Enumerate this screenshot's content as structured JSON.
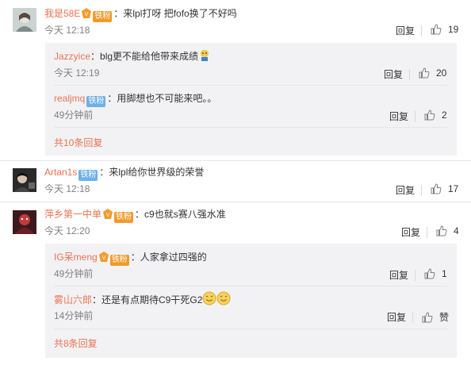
{
  "comments": [
    {
      "user": "我是58E",
      "badge": "铁粉",
      "text": "：来lpl打呀 把fofo换了不好吗",
      "time": "今天 12:18",
      "reply_label": "回复",
      "likes": "19",
      "replies": [
        {
          "user": "Jazzyice",
          "text": "：blg更不能给他带来成绩",
          "time": "今天 12:19",
          "reply_label": "回复",
          "likes": "20"
        },
        {
          "user": "realjmq",
          "badge": "铁粉",
          "text": "：用脚想也不可能来吧。。",
          "time": "49分钟前",
          "reply_label": "回复",
          "likes": "2"
        }
      ],
      "more": "共10条回复"
    },
    {
      "user": "Artan1s",
      "badge": "铁粉",
      "text": "：来lpl给你世界级的荣誉",
      "time": "今天 12:18",
      "reply_label": "回复",
      "likes": "17"
    },
    {
      "user": "萍乡第一中单",
      "badge": "铁粉",
      "text": "：c9也就s赛八强水准",
      "time": "今天 12:20",
      "reply_label": "回复",
      "likes": "4",
      "replies": [
        {
          "user": "IG呆meng",
          "badge": "铁粉",
          "text": "：人家拿过四强的",
          "time": "49分钟前",
          "reply_label": "回复",
          "likes": "1"
        },
        {
          "user": "雾山六郎",
          "text": "：还是有点期待C9干死G2",
          "time": "14分钟前",
          "reply_label": "回复",
          "likes": "赞"
        }
      ],
      "more": "共8条回复"
    }
  ],
  "colors": {
    "name": "#eb7350",
    "reply_bg": "#f2f2f5",
    "time": "#808080",
    "badge_blue": "#6cb0e8",
    "badge_orange": "#f09a2c"
  }
}
